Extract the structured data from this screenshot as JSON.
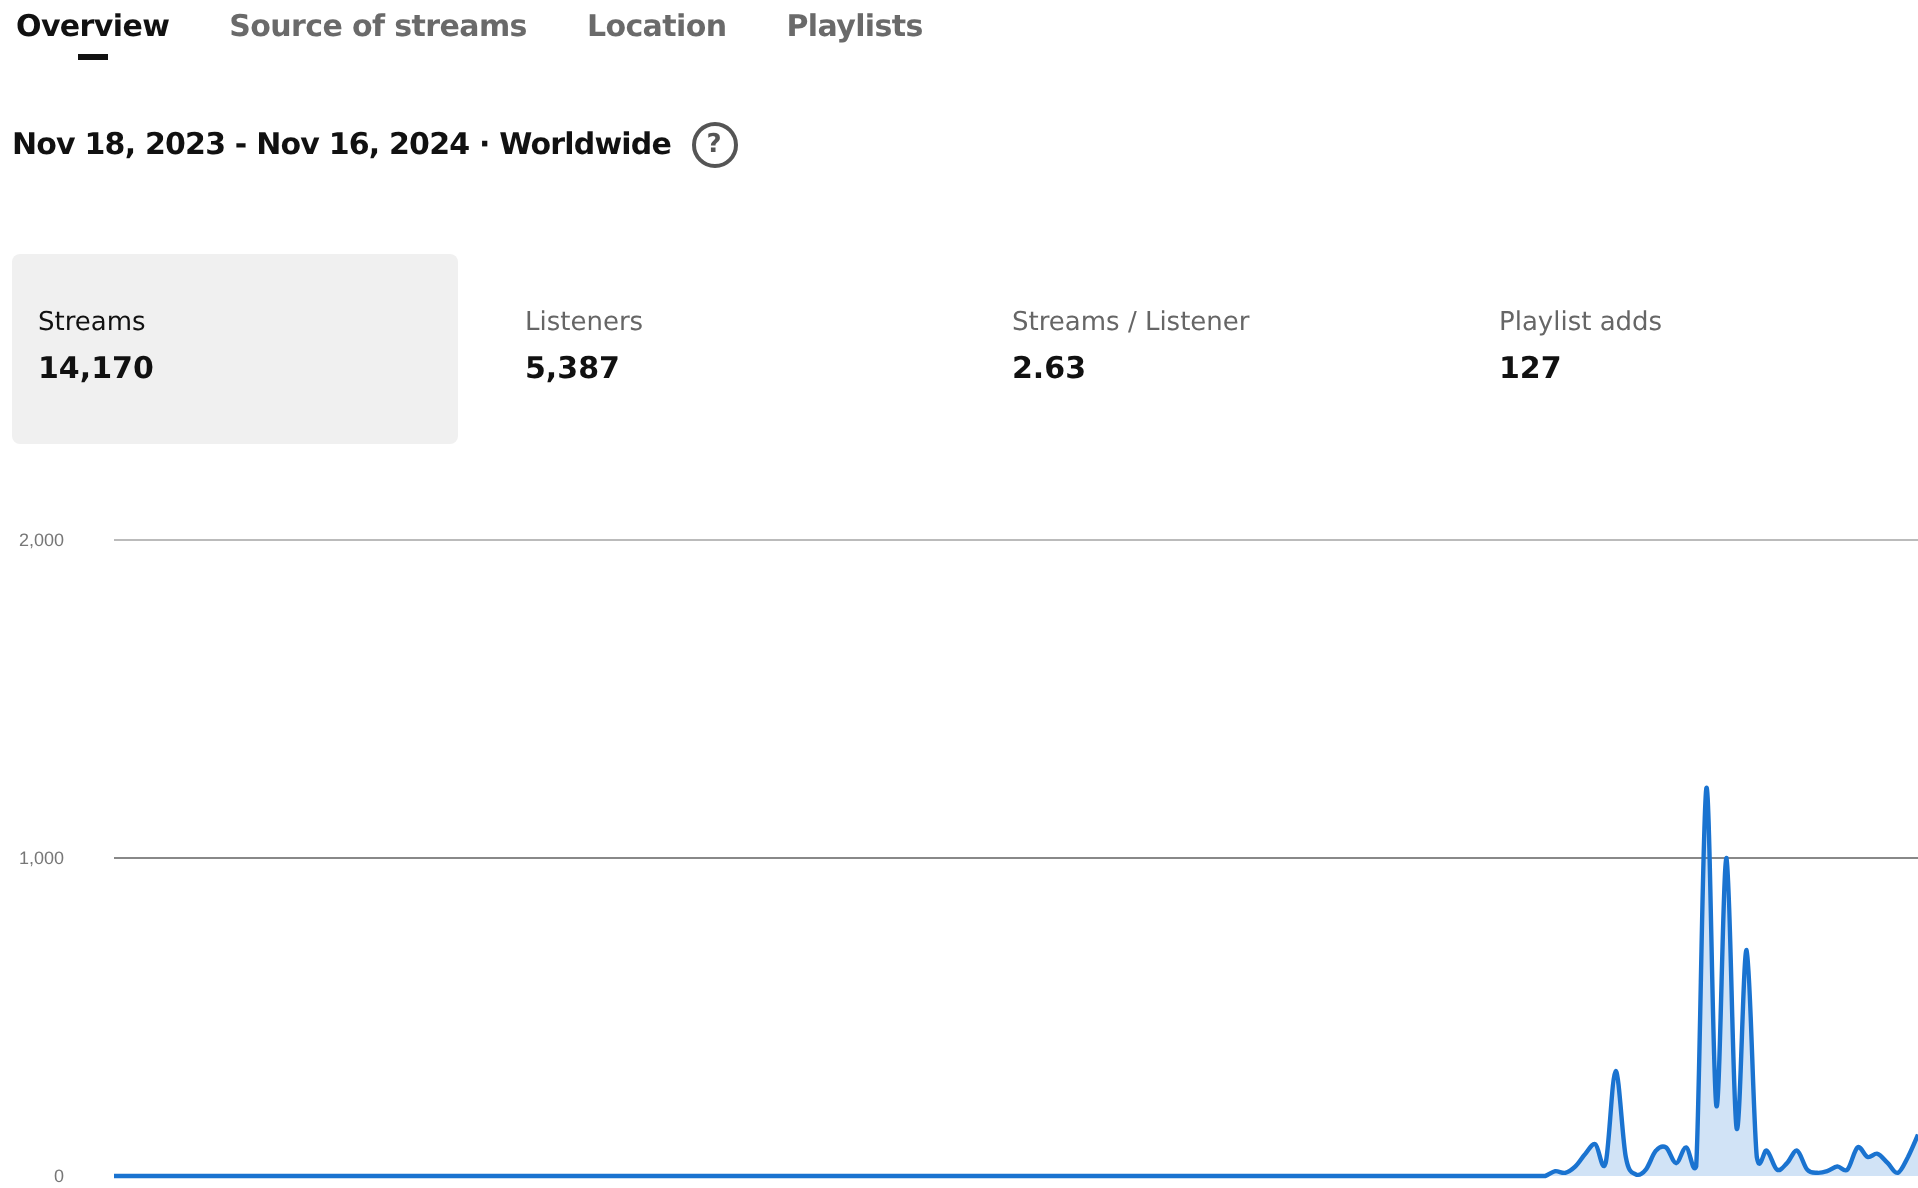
{
  "tabs": [
    {
      "label": "Overview",
      "selected": true
    },
    {
      "label": "Source of streams",
      "selected": false
    },
    {
      "label": "Location",
      "selected": false
    },
    {
      "label": "Playlists",
      "selected": false
    }
  ],
  "header": {
    "title": "Nov 18, 2023 - Nov 16, 2024 · Worldwide",
    "help_icon": "?"
  },
  "metrics": [
    {
      "label": "Streams",
      "value": "14,170",
      "selected": true
    },
    {
      "label": "Listeners",
      "value": "5,387",
      "selected": false
    },
    {
      "label": "Streams / Listener",
      "value": "2.63",
      "selected": false
    },
    {
      "label": "Playlist adds",
      "value": "127",
      "selected": false
    }
  ],
  "chart_data": {
    "type": "area",
    "ylim": [
      0,
      2000
    ],
    "yticks": [
      {
        "value": 0,
        "label": "0"
      },
      {
        "value": 1000,
        "label": "1,000"
      },
      {
        "value": 2000,
        "label": "2,000"
      }
    ],
    "series": [
      {
        "color": "#1a73d0",
        "values": [
          0,
          0,
          0,
          0,
          0,
          0,
          0,
          0,
          0,
          0,
          0,
          0,
          0,
          0,
          0,
          0,
          0,
          0,
          0,
          0,
          0,
          0,
          0,
          0,
          0,
          0,
          0,
          0,
          0,
          0,
          0,
          0,
          0,
          0,
          0,
          0,
          0,
          0,
          0,
          0,
          0,
          0,
          0,
          0,
          0,
          0,
          0,
          0,
          0,
          0,
          0,
          0,
          0,
          0,
          0,
          0,
          0,
          0,
          0,
          0,
          0,
          0,
          0,
          0,
          0,
          0,
          0,
          0,
          0,
          0,
          0,
          0,
          0,
          0,
          0,
          0,
          0,
          0,
          0,
          0,
          0,
          0,
          0,
          0,
          0,
          0,
          0,
          0,
          0,
          0,
          0,
          0,
          0,
          0,
          0,
          0,
          0,
          0,
          0,
          0,
          0,
          0,
          0,
          0,
          0,
          0,
          0,
          0,
          0,
          0,
          0,
          0,
          0,
          0,
          0,
          0,
          0,
          0,
          0,
          0,
          0,
          0,
          0,
          0,
          0,
          0,
          0,
          0,
          0,
          0,
          0,
          0,
          0,
          0,
          0,
          0,
          0,
          0,
          0,
          0,
          0,
          0,
          0,
          15,
          10,
          30,
          70,
          100,
          40,
          330,
          60,
          5,
          20,
          80,
          90,
          40,
          90,
          30,
          1220,
          220,
          1000,
          150,
          710,
          60,
          80,
          20,
          40,
          80,
          20,
          10,
          15,
          30,
          20,
          90,
          60,
          70,
          40,
          10,
          60,
          130
        ]
      }
    ]
  }
}
